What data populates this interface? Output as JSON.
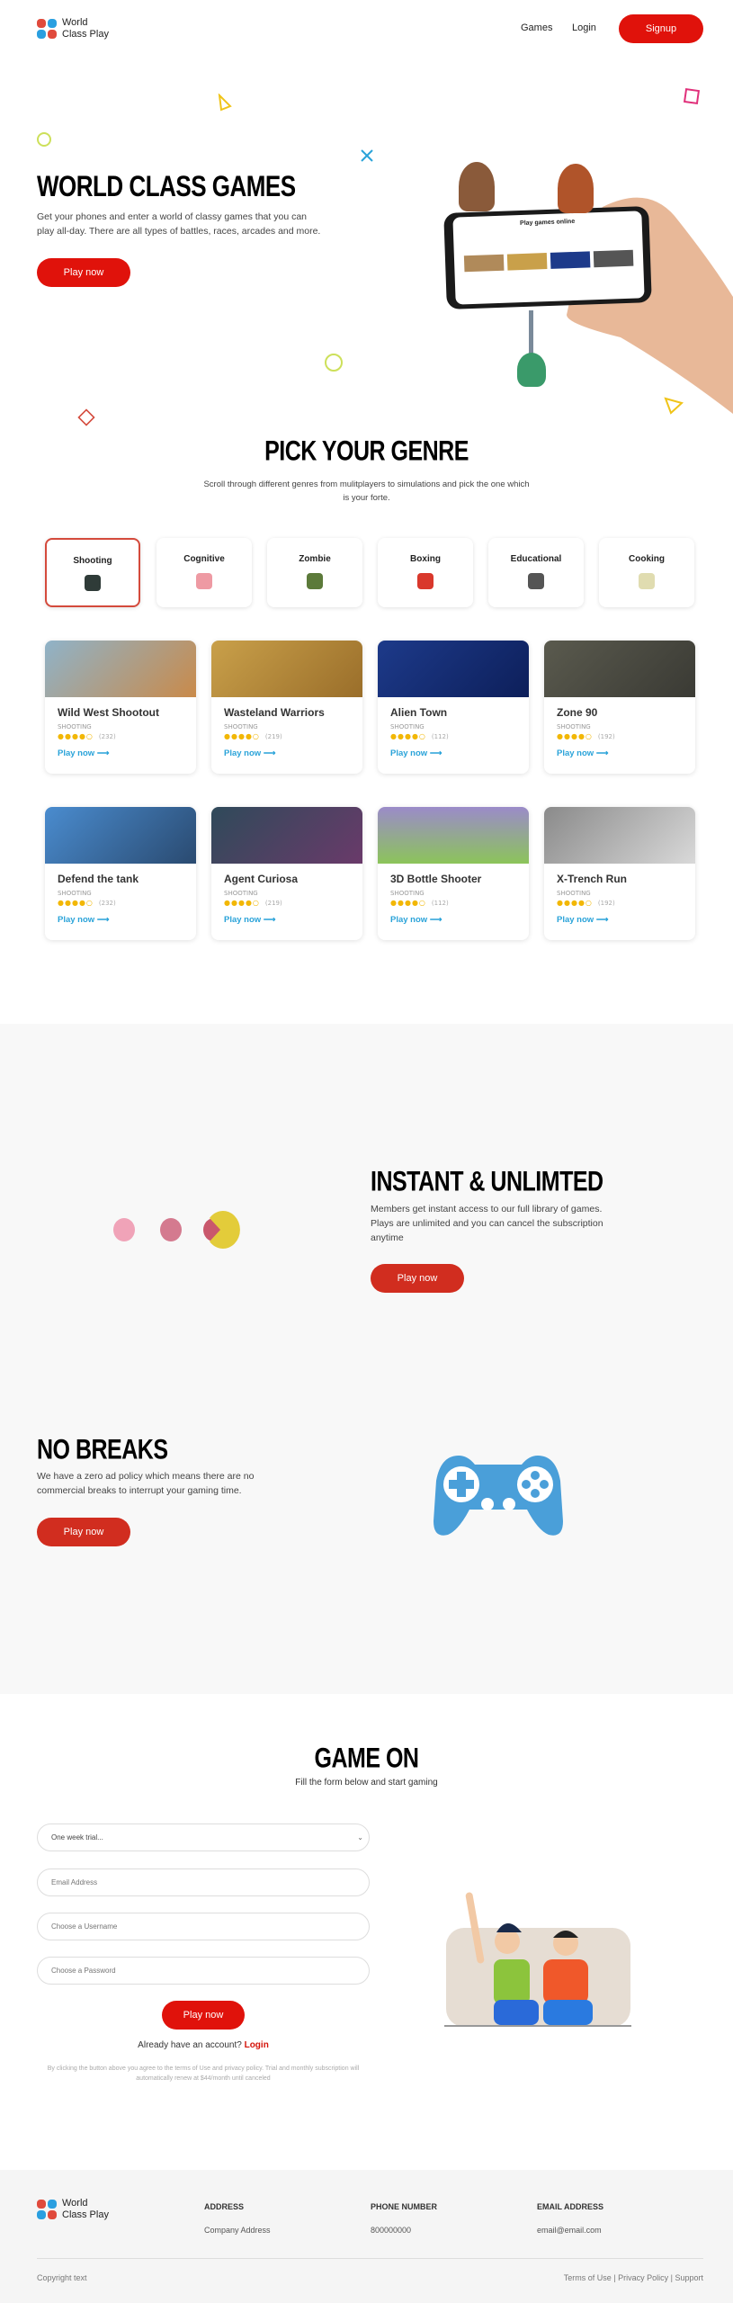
{
  "nav": {
    "logo_line1": "World",
    "logo_line2": "Class Play",
    "games": "Games",
    "login": "Login",
    "signup": "Signup"
  },
  "hero": {
    "title": "WORLD CLASS GAMES",
    "text": "Get your phones and enter a world of classy games that you can play all-day. There are all types of battles, races, arcades and more.",
    "cta": "Play now",
    "phone_screen_title": "Play games online"
  },
  "genre_section": {
    "title": "PICK YOUR GENRE",
    "subtitle": "Scroll through different genres from mulitplayers to simulations and pick the one which is your forte.",
    "genres": [
      {
        "label": "Shooting",
        "icon": "gun-icon",
        "color": "#2f3b38",
        "active": true
      },
      {
        "label": "Cognitive",
        "icon": "brain-icon",
        "color": "#ee9aa3"
      },
      {
        "label": "Zombie",
        "icon": "zombie-icon",
        "color": "#5c7a3a"
      },
      {
        "label": "Boxing",
        "icon": "boxing-glove-icon",
        "color": "#d9382c"
      },
      {
        "label": "Educational",
        "icon": "graduation-cap-icon",
        "color": "#555"
      },
      {
        "label": "Cooking",
        "icon": "cooking-pan-icon",
        "color": "#e0dcb0"
      }
    ]
  },
  "games": [
    {
      "title": "Wild West Shootout",
      "genre": "SHOOTING",
      "rating": 4,
      "reviews": "(232)",
      "play": "Play now",
      "art": "linear-gradient(135deg,#8fb3c9,#c98a4a)"
    },
    {
      "title": "Wasteland Warriors",
      "genre": "SHOOTING",
      "rating": 4,
      "reviews": "(219)",
      "play": "Play now",
      "art": "linear-gradient(135deg,#c9a04a,#9a6e2a)"
    },
    {
      "title": "Alien Town",
      "genre": "SHOOTING",
      "rating": 4,
      "reviews": "(112)",
      "play": "Play now",
      "art": "linear-gradient(135deg,#1d3a8a,#0d1f5a)"
    },
    {
      "title": "Zone 90",
      "genre": "SHOOTING",
      "rating": 4,
      "reviews": "(192)",
      "play": "Play now",
      "art": "linear-gradient(135deg,#5a5a4e,#3a3a34)"
    },
    {
      "title": "Defend the tank",
      "genre": "SHOOTING",
      "rating": 4,
      "reviews": "(232)",
      "play": "Play now",
      "art": "linear-gradient(135deg,#4a8ccf,#2a4a70)"
    },
    {
      "title": "Agent Curiosa",
      "genre": "SHOOTING",
      "rating": 4,
      "reviews": "(219)",
      "play": "Play now",
      "art": "linear-gradient(135deg,#2f4a5a,#6a3a6a)"
    },
    {
      "title": "3D Bottle Shooter",
      "genre": "SHOOTING",
      "rating": 4,
      "reviews": "(112)",
      "play": "Play now",
      "art": "linear-gradient(180deg,#9b8bc9,#8cc45a)"
    },
    {
      "title": "X-Trench Run",
      "genre": "SHOOTING",
      "rating": 4,
      "reviews": "(192)",
      "play": "Play now",
      "art": "linear-gradient(135deg,#8a8a8a,#d9d9d9)"
    }
  ],
  "instant": {
    "title": "INSTANT & UNLIMTED",
    "text": "Members get instant access to our full library of games. Plays are unlimited and you can cancel the subscription anytime",
    "cta": "Play now"
  },
  "nobreaks": {
    "title": "NO BREAKS",
    "text": "We have a zero ad policy which means there are no commercial breaks to interrupt your gaming time.",
    "cta": "Play now"
  },
  "signup": {
    "title": "GAME ON",
    "subtitle": "Fill the form below and start gaming",
    "plan_selected": "One week trial...",
    "email_placeholder": "Email Address",
    "username_placeholder": "Choose a Username",
    "password_placeholder": "Choose a Password",
    "cta": "Play now",
    "have_account": "Already have an account?",
    "login": "Login",
    "disclaimer": "By clicking the button above you agree to the terms of Use and privacy policy. Trial and monthly subscription will automatically renew at $44/month until canceled"
  },
  "footer": {
    "logo_line1": "World",
    "logo_line2": "Class Play",
    "address_h": "ADDRESS",
    "address": "Company Address",
    "phone_h": "PHONE NUMBER",
    "phone": "800000000",
    "email_h": "EMAIL ADDRESS",
    "email": "email@email.com",
    "copyright": "Copyright text",
    "terms": "Terms of Use",
    "privacy": "Privacy Policy",
    "support": "Support"
  },
  "colors": {
    "primary": "#e0120b",
    "link": "#2aa3d9",
    "star": "#f2b705",
    "section_bg": "#f8f8f8",
    "footer_bg": "#f5f5f5"
  }
}
